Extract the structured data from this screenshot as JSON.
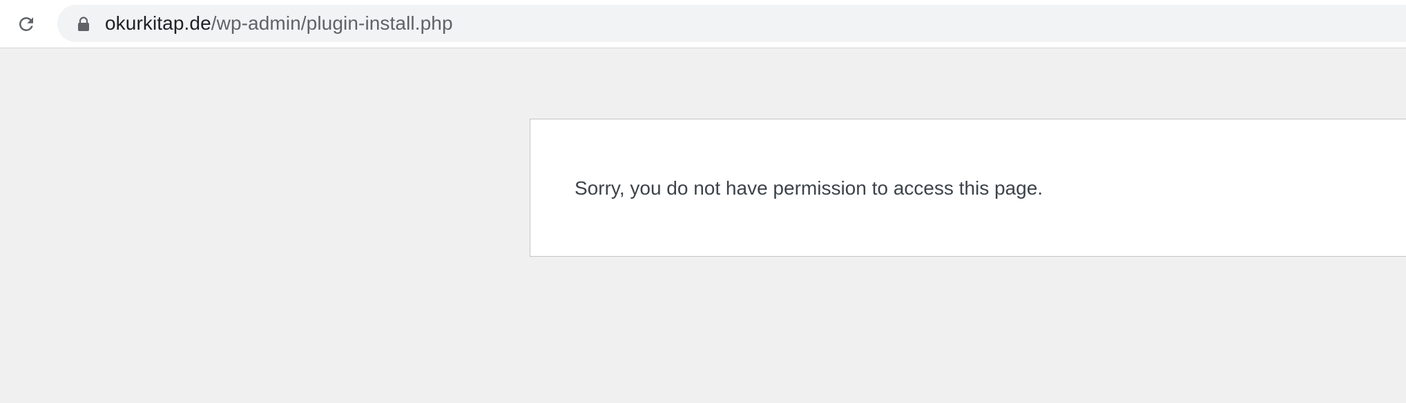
{
  "browser": {
    "reload_icon": "reload-icon",
    "lock_icon": "lock-icon",
    "url_host": "okurkitap.de",
    "url_path": "/wp-admin/plugin-install.php"
  },
  "page": {
    "error_message": "Sorry, you do not have permission to access this page."
  },
  "colors": {
    "page_background": "#f0f0f1",
    "box_background": "#ffffff",
    "box_border": "#c3c4c7",
    "message_text": "#3c434a",
    "omnibox_background": "#f1f3f4"
  }
}
